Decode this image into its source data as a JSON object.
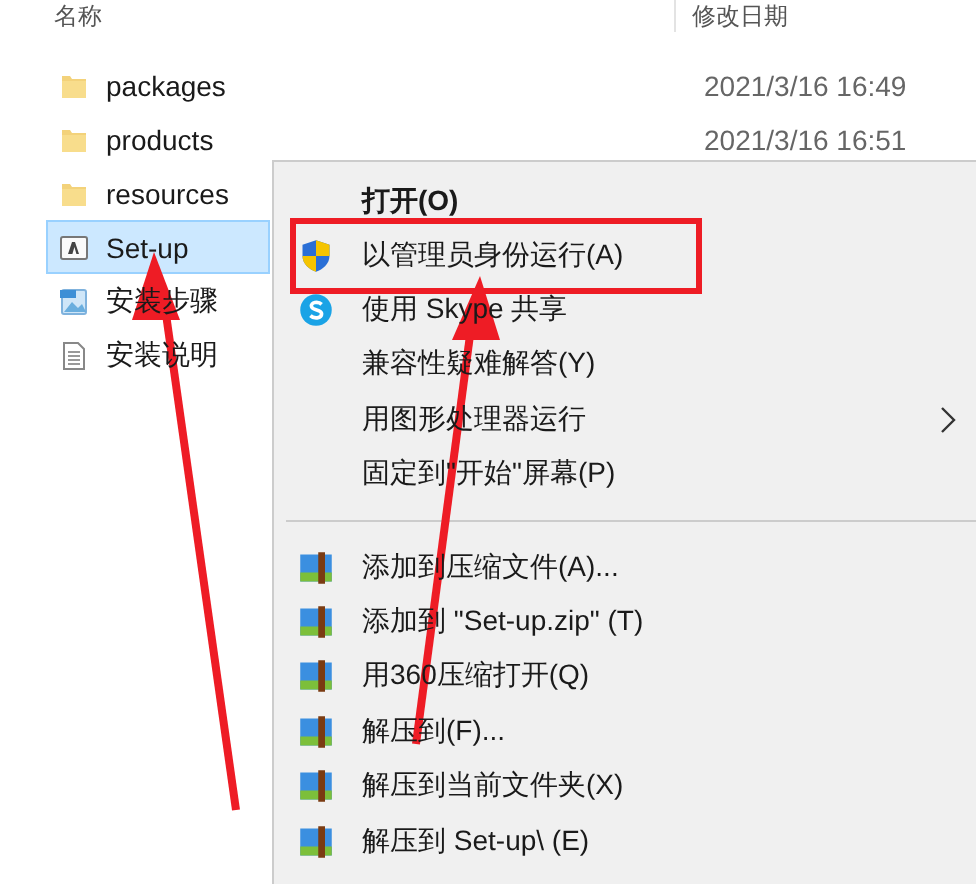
{
  "columns": [
    "名称",
    "修改日期"
  ],
  "files": [
    {
      "name": "packages",
      "date": "2021/3/16 16:49",
      "kind": "folder",
      "selected": false
    },
    {
      "name": "products",
      "date": "2021/3/16 16:51",
      "kind": "folder",
      "selected": false
    },
    {
      "name": "resources",
      "kind": "folder",
      "selected": false
    },
    {
      "name": "Set-up",
      "kind": "app",
      "selected": true
    },
    {
      "name": "安装步骤",
      "kind": "image",
      "selected": false
    },
    {
      "name": "安装说明",
      "kind": "text",
      "selected": false
    }
  ],
  "context_menu": [
    {
      "kind": "item",
      "label": "打开(O)",
      "bold": true,
      "highlighted": false,
      "submenu": false
    },
    {
      "kind": "admin",
      "label": "以管理员身份运行(A)",
      "bold": false,
      "highlighted": true,
      "submenu": false
    },
    {
      "kind": "share",
      "label": "使用 Skype 共享",
      "bold": false,
      "highlighted": false,
      "submenu": false
    },
    {
      "kind": "item",
      "label": "兼容性疑难解答(Y)",
      "bold": false,
      "highlighted": false,
      "submenu": false
    },
    {
      "kind": "item",
      "label": "用图形处理器运行",
      "bold": false,
      "highlighted": false,
      "submenu": true
    },
    {
      "kind": "item",
      "label": "固定到\"开始\"屏幕(P)",
      "bold": false,
      "highlighted": false,
      "submenu": false
    },
    {
      "kind": "separator"
    },
    {
      "kind": "archive",
      "label": "添加到压缩文件(A)...",
      "bold": false,
      "highlighted": false,
      "submenu": false
    },
    {
      "kind": "archive",
      "label": "添加到 \"Set-up.zip\" (T)",
      "bold": false,
      "highlighted": false,
      "submenu": false
    },
    {
      "kind": "archive",
      "label": "用360压缩打开(Q)",
      "bold": false,
      "highlighted": false,
      "submenu": false
    },
    {
      "kind": "archive",
      "label": "解压到(F)...",
      "bold": false,
      "highlighted": false,
      "submenu": false
    },
    {
      "kind": "archive",
      "label": "解压到当前文件夹(X)",
      "bold": false,
      "highlighted": false,
      "submenu": false
    },
    {
      "kind": "archive",
      "label": "解压到 Set-up\\ (E)",
      "bold": false,
      "highlighted": false,
      "submenu": false
    }
  ]
}
